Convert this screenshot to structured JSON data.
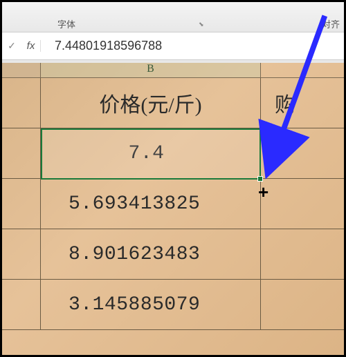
{
  "ribbon": {
    "font_group_label": "字体",
    "align_group_label": "对齐"
  },
  "formula_bar": {
    "fx_label": "fx",
    "value": "7.44801918596788"
  },
  "columns": {
    "b_label": "B"
  },
  "table": {
    "header_b": "价格(元/斤)",
    "header_c": "购",
    "b2": "7.4",
    "b3": "5.693413825",
    "b4": "8.901623483",
    "b5": "3.145885079"
  }
}
